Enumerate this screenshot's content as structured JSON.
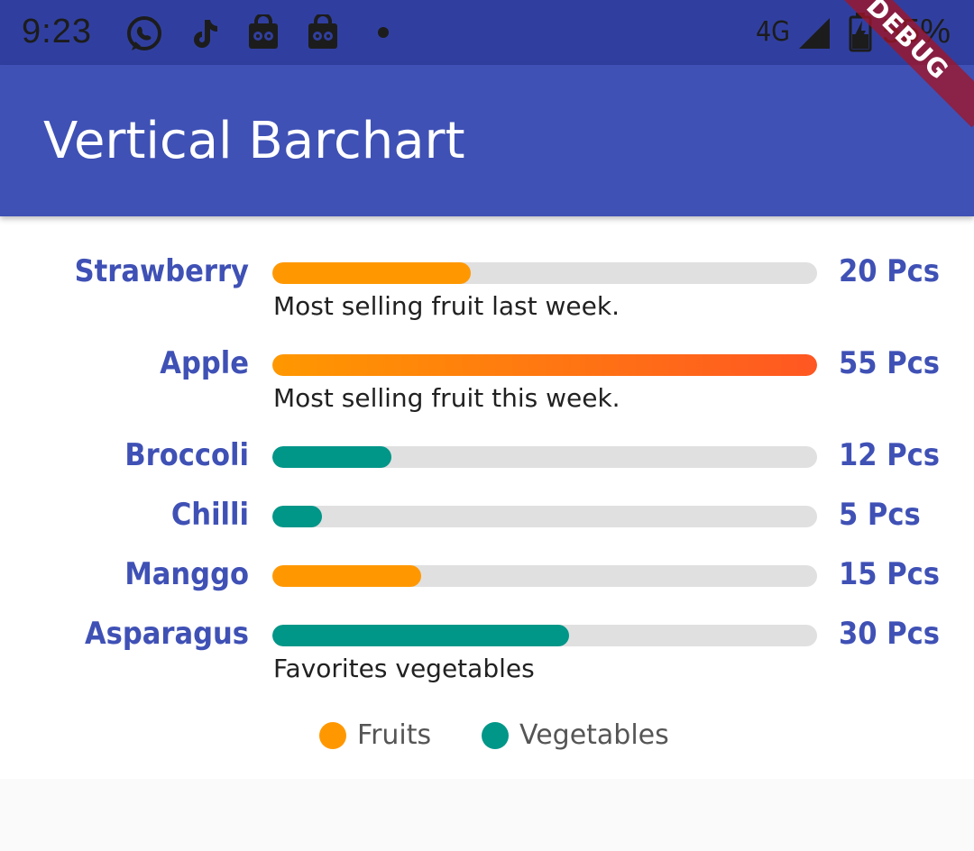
{
  "status_bar": {
    "time": "9:23",
    "network": "4G",
    "battery": "55%",
    "notification_icons": [
      "whatsapp-icon",
      "tiktok-icon",
      "shopping-bag-icon",
      "shopping-bag-icon",
      "dot-icon"
    ]
  },
  "app_bar": {
    "title": "Vertical Barchart"
  },
  "debug_banner": "DEBUG",
  "colors": {
    "primary": "#3f51b5",
    "primary_dark": "#303f9f",
    "fruit": "#ff9800",
    "fruit_gradient_end": "#ff5722",
    "vegetable": "#009688",
    "track": "#e0e0e0"
  },
  "chart_data": {
    "type": "bar",
    "orientation": "horizontal",
    "categories": [
      "Strawberry",
      "Apple",
      "Broccoli",
      "Chilli",
      "Manggo",
      "Asparagus"
    ],
    "values": [
      20,
      55,
      12,
      5,
      15,
      30
    ],
    "value_labels": [
      "20 Pcs",
      "55 Pcs",
      "12 Pcs",
      "5 Pcs",
      "15 Pcs",
      "30 Pcs"
    ],
    "groups": [
      "Fruits",
      "Fruits",
      "Vegetables",
      "Vegetables",
      "Fruits",
      "Vegetables"
    ],
    "captions": [
      "Most selling fruit last week.",
      "Most selling fruit this week.",
      "",
      "",
      "",
      "Favorites vegetables"
    ],
    "xlim": [
      0,
      55
    ],
    "legend": [
      {
        "name": "Fruits",
        "color": "#ff9800"
      },
      {
        "name": "Vegetables",
        "color": "#009688"
      }
    ],
    "legend_position": "bottom-center"
  }
}
